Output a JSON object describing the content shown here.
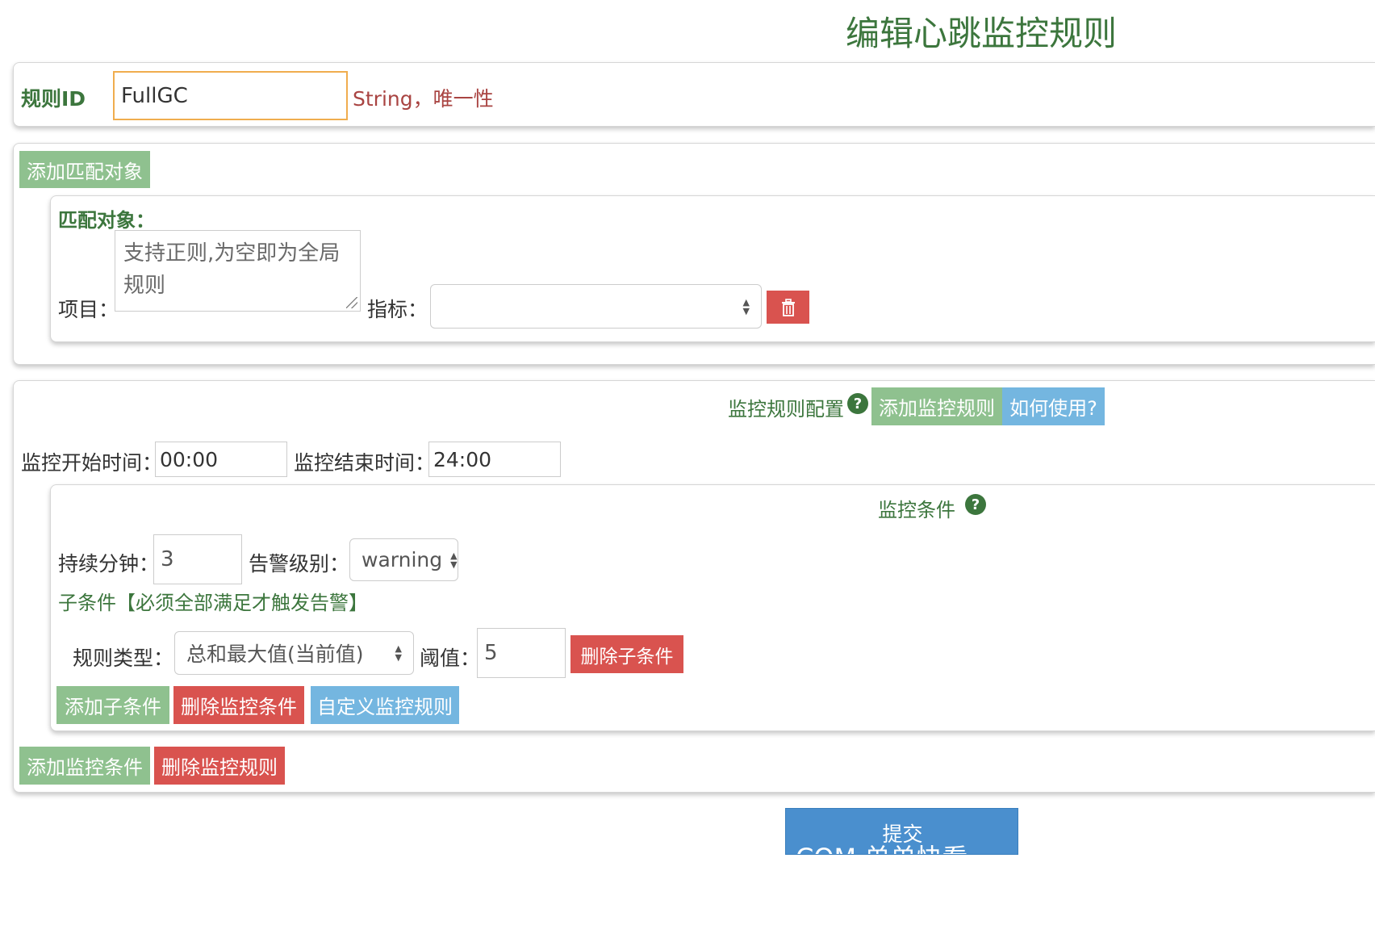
{
  "page": {
    "title": "编辑心跳监控规则"
  },
  "rule_id": {
    "label": "规则ID",
    "value": "FullGC",
    "hint": "String，唯一性"
  },
  "match_section": {
    "add_button": "添加匹配对象",
    "heading": "匹配对象：",
    "project_label": "项目：",
    "project_placeholder": "支持正则,为空即为全局规则",
    "metric_label": "指标：",
    "metric_value": "",
    "delete_icon": "trash-icon"
  },
  "monitor_section": {
    "config_label": "监控规则配置",
    "add_rule_button": "添加监控规则",
    "how_to_button": "如何使用?",
    "start_label": "监控开始时间：",
    "start_value": "00:00",
    "end_label": "监控结束时间：",
    "end_value": "24:00",
    "condition": {
      "heading": "监控条件",
      "duration_label": "持续分钟：",
      "duration_value": "3",
      "level_label": "告警级别：",
      "level_value": "warning",
      "sub_heading": "子条件【必须全部满足才触发告警】",
      "rule_type_label": "规则类型：",
      "rule_type_value": "总和最大值(当前值)",
      "threshold_label": "阈值：",
      "threshold_value": "5",
      "delete_sub_button": "删除子条件",
      "add_sub_button": "添加子条件",
      "delete_condition_button": "删除监控条件",
      "custom_rule_button": "自定义监控规则"
    },
    "add_condition_button": "添加监控条件",
    "delete_rule_button": "删除监控规则"
  },
  "submit": {
    "label": "提交",
    "overlap_text": "COM 单单快看"
  },
  "colors": {
    "accent_green": "#3c763d",
    "btn_green": "#8fc18f",
    "btn_red": "#d9534f",
    "btn_blue": "#74b6e0",
    "btn_primary": "#4a8fce",
    "hint_red": "#a94442",
    "focus_orange": "#f0ad4e"
  }
}
